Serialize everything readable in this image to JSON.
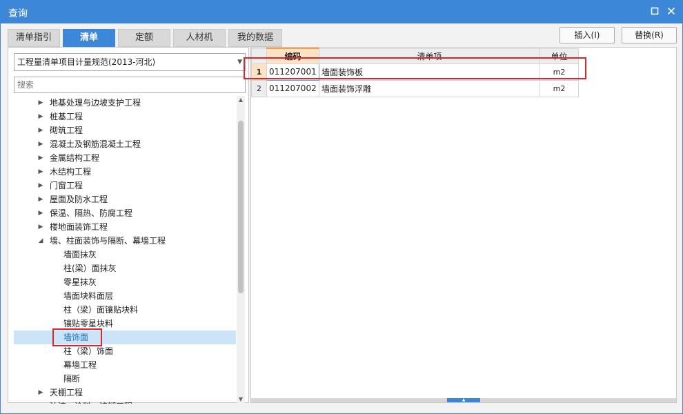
{
  "window": {
    "title": "查询",
    "maximize_icon": "maximize-icon",
    "close_icon": "close-icon"
  },
  "tabs": [
    {
      "label": "清单指引",
      "active": false
    },
    {
      "label": "清单",
      "active": true
    },
    {
      "label": "定额",
      "active": false
    },
    {
      "label": "人材机",
      "active": false
    },
    {
      "label": "我的数据",
      "active": false
    }
  ],
  "buttons": {
    "insert": "插入(I)",
    "replace": "替换(R)"
  },
  "left_panel": {
    "spec_select": "工程量清单项目计量规范(2013-河北)",
    "search_placeholder": "搜索",
    "tree": [
      {
        "label": "地基处理与边坡支护工程",
        "level": 0,
        "expanded": false
      },
      {
        "label": "桩基工程",
        "level": 0,
        "expanded": false
      },
      {
        "label": "砌筑工程",
        "level": 0,
        "expanded": false
      },
      {
        "label": "混凝土及钢筋混凝土工程",
        "level": 0,
        "expanded": false
      },
      {
        "label": "金属结构工程",
        "level": 0,
        "expanded": false
      },
      {
        "label": "木结构工程",
        "level": 0,
        "expanded": false
      },
      {
        "label": "门窗工程",
        "level": 0,
        "expanded": false
      },
      {
        "label": "屋面及防水工程",
        "level": 0,
        "expanded": false
      },
      {
        "label": "保温、隔热、防腐工程",
        "level": 0,
        "expanded": false
      },
      {
        "label": "楼地面装饰工程",
        "level": 0,
        "expanded": false
      },
      {
        "label": "墙、柱面装饰与隔断、幕墙工程",
        "level": 0,
        "expanded": true
      },
      {
        "label": "墙面抹灰",
        "level": 1
      },
      {
        "label": "柱(梁）面抹灰",
        "level": 1
      },
      {
        "label": "零星抹灰",
        "level": 1
      },
      {
        "label": "墙面块料面层",
        "level": 1
      },
      {
        "label": "柱（梁）面镶贴块料",
        "level": 1
      },
      {
        "label": "镶贴零星块料",
        "level": 1
      },
      {
        "label": "墙饰面",
        "level": 1,
        "selected": true
      },
      {
        "label": "柱（梁）饰面",
        "level": 1
      },
      {
        "label": "幕墙工程",
        "level": 1
      },
      {
        "label": "隔断",
        "level": 1
      },
      {
        "label": "天棚工程",
        "level": 0,
        "expanded": false
      },
      {
        "label": "油漆、涂料、裱糊工程",
        "level": 0,
        "expanded": false
      }
    ]
  },
  "grid": {
    "columns": [
      "编码",
      "清单项",
      "单位"
    ],
    "rows": [
      {
        "no": "1",
        "code": "011207001",
        "name": "墙面装饰板",
        "unit": "m2"
      },
      {
        "no": "2",
        "code": "011207002",
        "name": "墙面装饰浮雕",
        "unit": "m2"
      }
    ]
  },
  "colors": {
    "accent": "#3d87d9",
    "highlight_box": "#d9262c",
    "selected_row": "#cce4f7",
    "sorted_header": "#fde2c3"
  }
}
